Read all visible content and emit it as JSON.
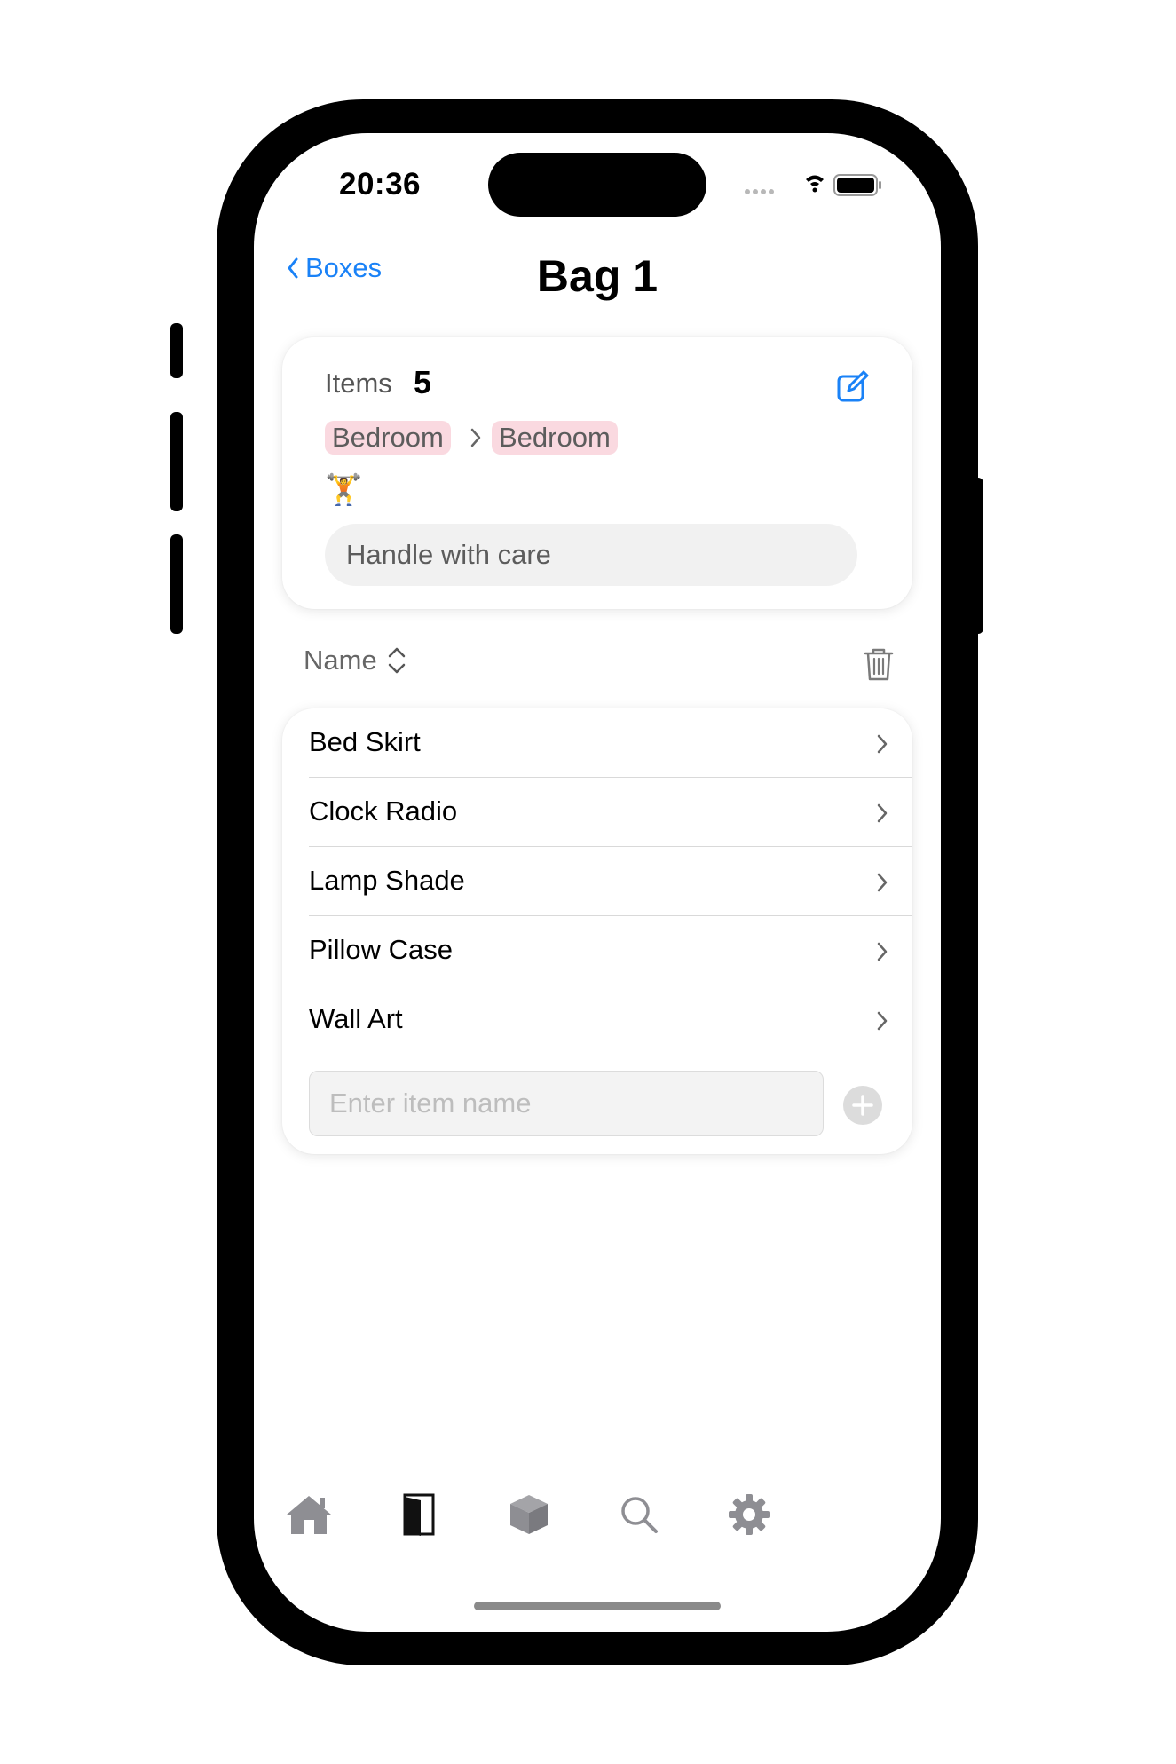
{
  "status_bar": {
    "time": "20:36"
  },
  "nav": {
    "back_label": "Boxes",
    "title": "Bag 1"
  },
  "box_info": {
    "items_label": "Items",
    "items_count": "5",
    "location_chips": [
      "Bedroom",
      "Bedroom"
    ],
    "chip_color": "#fad9e0",
    "emoji": "🏋",
    "note_value": "Handle with care"
  },
  "sort": {
    "label": "Name"
  },
  "items": [
    {
      "label": "Bed Skirt"
    },
    {
      "label": "Clock Radio"
    },
    {
      "label": "Lamp Shade"
    },
    {
      "label": "Pillow Case"
    },
    {
      "label": "Wall Art"
    }
  ],
  "add_item": {
    "placeholder": "Enter item name"
  },
  "tab_bar": {
    "tabs": [
      {
        "icon": "house-icon",
        "selected": false
      },
      {
        "icon": "door-icon",
        "selected": true
      },
      {
        "icon": "box-icon",
        "selected": false
      },
      {
        "icon": "search-icon",
        "selected": false
      },
      {
        "icon": "gear-icon",
        "selected": false
      }
    ]
  },
  "colors": {
    "accent": "#1a82f7",
    "tab_inactive": "#8e8e93",
    "tab_active": "#111111"
  }
}
